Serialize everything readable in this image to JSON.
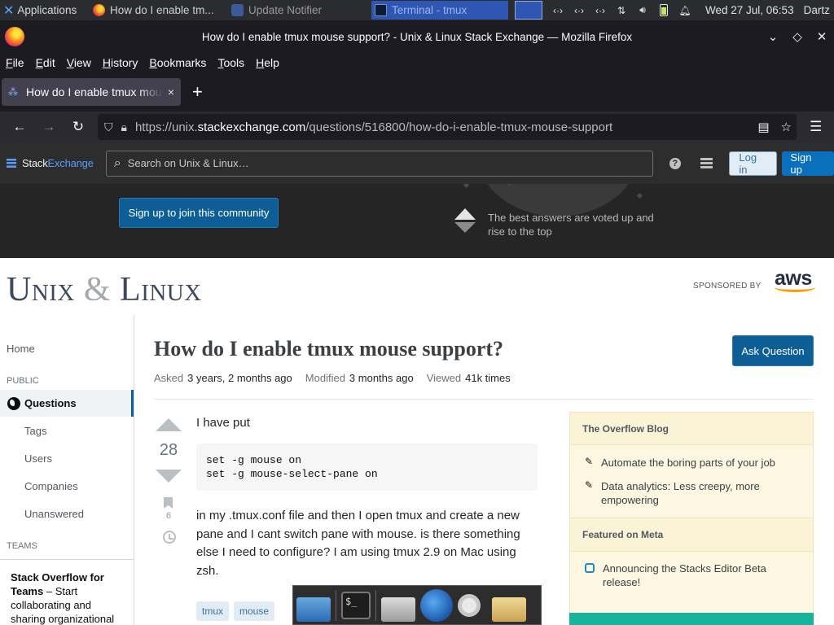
{
  "panel": {
    "apps_label": "Applications",
    "tasks": [
      {
        "label": "How do I enable tm..."
      },
      {
        "label": "Update Notifier"
      },
      {
        "label": "Terminal - tmux"
      }
    ],
    "clock": "Wed 27 Jul, 06:53",
    "user": "Dartz"
  },
  "window": {
    "title": "How do I enable tmux mouse support? - Unix & Linux Stack Exchange — Mozilla Firefox"
  },
  "menubar": [
    "File",
    "Edit",
    "View",
    "History",
    "Bookmarks",
    "Tools",
    "Help"
  ],
  "tab": {
    "label": "How do I enable tmux mouse support?",
    "close": "×",
    "new_tab": "+"
  },
  "url": {
    "prefix": "https://unix.",
    "host": "stackexchange.com",
    "path": "/questions/516800/how-do-i-enable-tmux-mouse-support"
  },
  "se_topbar": {
    "logo_stack": "Stack",
    "logo_exchange": "Exchange",
    "search_placeholder": "Search on Unix & Linux…",
    "help": "?",
    "login": "Log in",
    "signup": "Sign up"
  },
  "hero": {
    "signup_button": "Sign up to join this community",
    "votes_text": "The best answers are voted up and rise to the top"
  },
  "site": {
    "name_part1": "Unix ",
    "name_amp": "&",
    "name_part2": " Linux",
    "sponsored": "SPONSORED BY",
    "sponsor": "aws"
  },
  "left_nav": {
    "home": "Home",
    "public": "PUBLIC",
    "questions": "Questions",
    "tags": "Tags",
    "users": "Users",
    "companies": "Companies",
    "unanswered": "Unanswered",
    "teams": "TEAMS",
    "teams_title": "Stack Overflow for Teams",
    "teams_text": " – Start collaborating and sharing organizational"
  },
  "question": {
    "title": "How do I enable tmux mouse support?",
    "ask_button": "Ask Question",
    "asked_label": "Asked",
    "asked_value": "3 years, 2 months ago",
    "modified_label": "Modified",
    "modified_value": "3 months ago",
    "viewed_label": "Viewed",
    "viewed_value": "41k times",
    "votes": "28",
    "bookmarks": "6",
    "intro": "I have put",
    "code": "set -g mouse on\nset -g mouse-select-pane on",
    "body": "in my .tmux.conf file and then I open tmux and create a new pane and I cant switch pane with mouse. is there something else I need to configure? I am using tmux 2.9 on Mac using zsh.",
    "tags": [
      "tmux",
      "mouse"
    ]
  },
  "sidebar": {
    "blog_header": "The Overflow Blog",
    "blog_items": [
      "Automate the boring parts of your job",
      "Data analytics: Less creepy, more empowering"
    ],
    "meta_header": "Featured on Meta",
    "meta_items": [
      "Announcing the Stacks Editor Beta release!"
    ]
  }
}
